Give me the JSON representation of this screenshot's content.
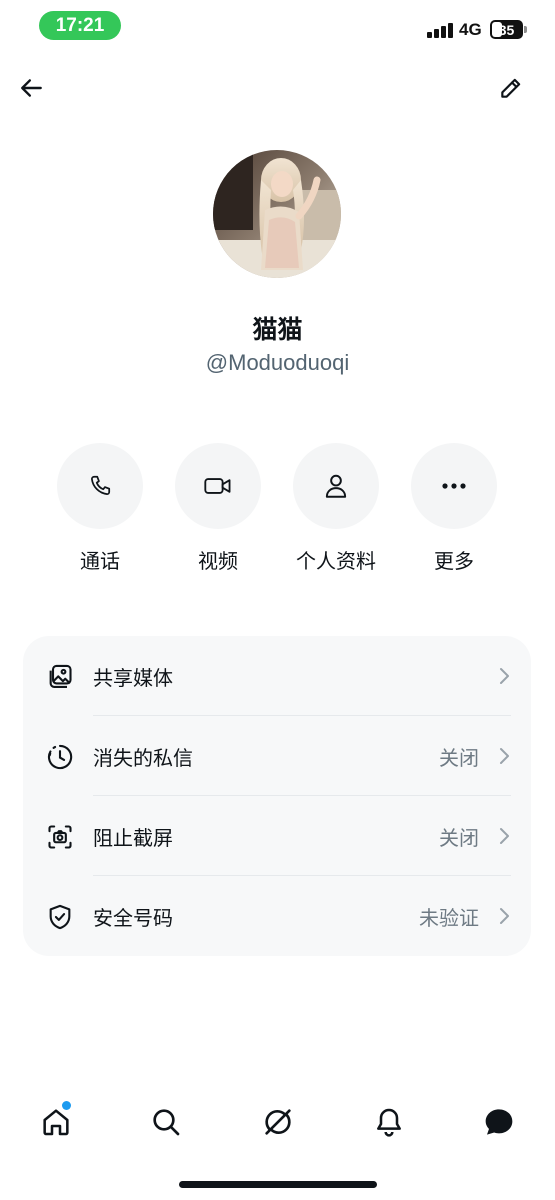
{
  "status_bar": {
    "time": "17:21",
    "network": "4G",
    "battery": "35",
    "time_pill_color": "#34c759"
  },
  "nav": {
    "back_icon": "arrow-left-icon",
    "edit_icon": "pencil-icon"
  },
  "profile": {
    "name": "猫猫",
    "handle": "@Moduoduoqi"
  },
  "actions": [
    {
      "label": "通话",
      "icon": "phone-icon"
    },
    {
      "label": "视频",
      "icon": "video-camera-icon"
    },
    {
      "label": "个人资料",
      "icon": "person-icon"
    },
    {
      "label": "更多",
      "icon": "more-dots-icon"
    }
  ],
  "settings": [
    {
      "label": "共享媒体",
      "value": "",
      "icon": "gallery-icon"
    },
    {
      "label": "消失的私信",
      "value": "关闭",
      "icon": "timer-icon"
    },
    {
      "label": "阻止截屏",
      "value": "关闭",
      "icon": "screenshot-icon"
    },
    {
      "label": "安全号码",
      "value": "未验证",
      "icon": "shield-check-icon"
    }
  ],
  "tab_bar": [
    {
      "icon": "home-icon",
      "has_notification": true
    },
    {
      "icon": "search-icon"
    },
    {
      "icon": "grok-icon"
    },
    {
      "icon": "bell-icon"
    },
    {
      "icon": "messages-icon",
      "active": true
    }
  ],
  "colors": {
    "accent_dot": "#1d9bf0",
    "text_primary": "#0f1419",
    "text_secondary": "#536471"
  }
}
